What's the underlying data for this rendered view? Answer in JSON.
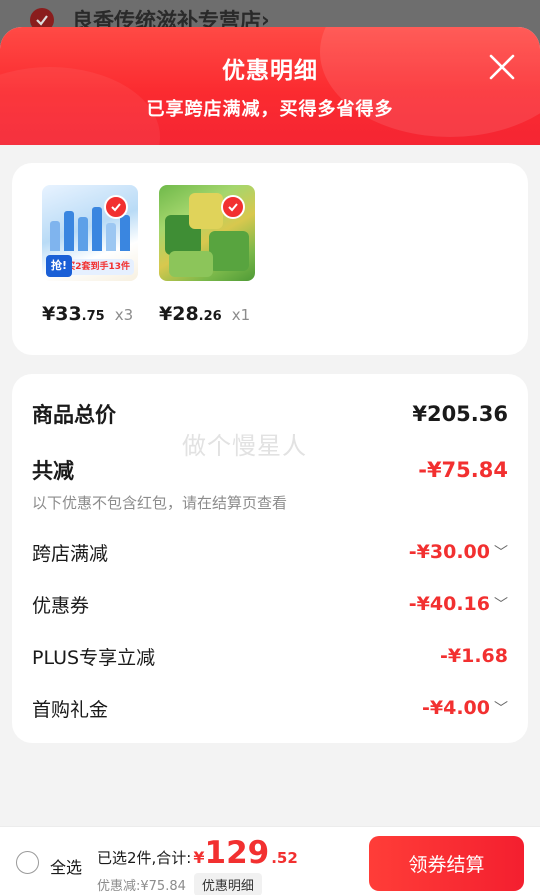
{
  "background": {
    "store_name": "良香传统滋补专营店",
    "chevron": "›"
  },
  "header": {
    "title": "优惠明细",
    "subtitle": "已享跨店满减，买得多省得多"
  },
  "goods": [
    {
      "price_int": "¥33",
      "price_dec": ".75",
      "qty": "x3",
      "promo_badge": "抢!",
      "promo_text": "买2套到手13件"
    },
    {
      "price_int": "¥28",
      "price_dec": ".26",
      "qty": "x1"
    }
  ],
  "summary": {
    "total_label": "商品总价",
    "total_value": "¥205.36",
    "watermark": "做个慢星人",
    "reduce_label": "共减",
    "reduce_value": "-¥75.84",
    "note": "以下优惠不包含红包，请在结算页查看"
  },
  "discounts": [
    {
      "label": "跨店满减",
      "value": "-¥30.00",
      "expandable": true
    },
    {
      "label": "优惠券",
      "value": "-¥40.16",
      "expandable": true
    },
    {
      "label": "PLUS专享立减",
      "value": "-¥1.68",
      "expandable": false
    },
    {
      "label": "首购礼金",
      "value": "-¥4.00",
      "expandable": true
    }
  ],
  "footer": {
    "select_all": "全选",
    "selected_label": "已选2件,合计:",
    "yen": "¥",
    "total_int": "129",
    "total_dec": ".52",
    "discount_text": "优惠减:¥75.84",
    "detail_button": "优惠明细",
    "checkout_button": "领券结算"
  },
  "colors": {
    "accent": "#f23030",
    "header_red": "#fb2b30"
  }
}
